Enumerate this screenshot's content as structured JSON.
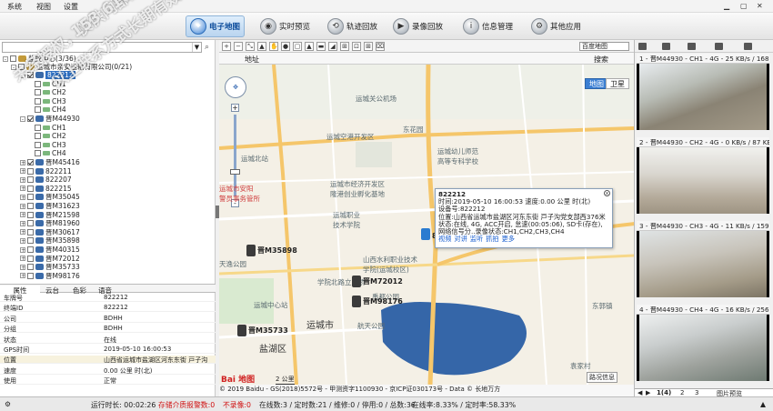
{
  "menu": {
    "system": "系统",
    "view": "视图",
    "settings": "设置"
  },
  "nav": {
    "items": [
      {
        "label": "电子地图",
        "icon": "map-icon"
      },
      {
        "label": "实时预览",
        "icon": "camera-icon"
      },
      {
        "label": "轨迹回放",
        "icon": "track-icon"
      },
      {
        "label": "录像回放",
        "icon": "video-icon"
      },
      {
        "label": "信息管理",
        "icon": "info-icon"
      },
      {
        "label": "其他应用",
        "icon": "apps-icon"
      }
    ]
  },
  "tree": {
    "root": "监控中心(3/36)",
    "company": "运城市亲安运输有限公司(0/21)",
    "vehicles": [
      {
        "label": "822212",
        "selected": true
      },
      {
        "label": "CH1"
      },
      {
        "label": "CH2"
      },
      {
        "label": "CH3"
      },
      {
        "label": "CH4"
      },
      {
        "label": "晋M44930"
      },
      {
        "label": "CH1"
      },
      {
        "label": "CH2"
      },
      {
        "label": "CH3"
      },
      {
        "label": "CH4"
      },
      {
        "label": "晋M45416"
      },
      {
        "label": "822211"
      },
      {
        "label": "822207"
      },
      {
        "label": "822215"
      },
      {
        "label": "晋M35045"
      },
      {
        "label": "晋M31623"
      },
      {
        "label": "晋M21598"
      },
      {
        "label": "晋M81960"
      },
      {
        "label": "晋M30617"
      },
      {
        "label": "晋M35898"
      },
      {
        "label": "晋M40315"
      },
      {
        "label": "晋M72012"
      },
      {
        "label": "晋M35733"
      },
      {
        "label": "晋M98176"
      }
    ]
  },
  "property_tabs": [
    "属性",
    "云台",
    "色彩",
    "语音"
  ],
  "properties": [
    {
      "k": "车牌号",
      "v": "822212"
    },
    {
      "k": "终端ID",
      "v": "822212"
    },
    {
      "k": "公司",
      "v": "BDHH"
    },
    {
      "k": "分组",
      "v": "BDHH"
    },
    {
      "k": "状态",
      "v": "在线"
    },
    {
      "k": "GPS时间",
      "v": "2019-05-10 16:00:53"
    },
    {
      "k": "位置",
      "v": "山西省运城市盐湖区河东东街 戸子沟"
    },
    {
      "k": "速度",
      "v": "0.00 公里 时(北)"
    },
    {
      "k": "使用",
      "v": "正常"
    }
  ],
  "map": {
    "address_label": "地址",
    "search_label": "搜索",
    "map_type": "百度地图",
    "type_map": "地图",
    "type_satellite": "卫星",
    "places": [
      {
        "t": "运城关公机场"
      },
      {
        "t": "运城空港开发区"
      },
      {
        "t": "运城北站"
      },
      {
        "t": "运城市经济开发区\n隆港创业孵化基地"
      },
      {
        "t": "运城幼儿师范\n高等专科学校"
      },
      {
        "t": "东花园"
      },
      {
        "t": "运城职业\n技术学院"
      },
      {
        "t": "山西水利职业技术\n学院(运城校区)"
      },
      {
        "t": "学院北路立交桥"
      },
      {
        "t": "运城中心站"
      },
      {
        "t": "运城市"
      },
      {
        "t": "盐湖区"
      },
      {
        "t": "航天公园"
      },
      {
        "t": "禹都公园"
      },
      {
        "t": "运城市安阳\n警员事务管所"
      },
      {
        "t": "天逸公园"
      },
      {
        "t": "袁家村"
      },
      {
        "t": "东郭镇"
      }
    ],
    "vehicles": [
      {
        "label": "822212"
      },
      {
        "label": "晋M35898"
      },
      {
        "label": "晋M72012"
      },
      {
        "label": "晋M35733"
      },
      {
        "label": "晋M98176"
      }
    ],
    "popup": {
      "title": "822212",
      "time": "时间:2019-05-10 16:00:53  速度:0.00 公里 时(北)",
      "device": "设备号:822212",
      "address": "位置:山西省运城市盐湖区河东东街 戸子沟党支部西376米",
      "status": "状态:在线, 4G, ACC开启, 怠速(00:05:06), SD卡(存在), 网络信号分..录像状态:CH1,CH2,CH3,CH4",
      "actions": [
        "视频",
        "对讲",
        "监听",
        "抓拍",
        "更多"
      ]
    },
    "footer": "© 2019 Baidu - GS(2018)5572号 - 甲测资字1100930 - 京ICP证030173号 - Data © 长地万方",
    "baidu_logo": "Bai 地图",
    "scale": "2 公里",
    "road_info": "路况信息"
  },
  "video": {
    "toolbar_icons": [
      "layout-icon",
      "grid-icon",
      "camera-icon",
      "record-icon",
      "play-icon"
    ],
    "panels": [
      {
        "head": "1 - 晋M44930 - CH1 - 4G - 25 KB/s / 168 KB"
      },
      {
        "head": "2 - 晋M44930 - CH2 - 4G - 0 KB/s / 87 KB"
      },
      {
        "head": "3 - 晋M44930 - CH3 - 4G - 11 KB/s / 159 KB"
      },
      {
        "head": "4 - 晋M44930 - CH4 - 4G - 16 KB/s / 256 KB"
      }
    ],
    "page": "1(4)",
    "pages": [
      "2",
      "3"
    ],
    "preview": "图片预览"
  },
  "status": {
    "runtime": "运行时长: 00:02:26",
    "alarm": "存储介质报警数:0",
    "unhandled": "不录像:0",
    "online": "在线数:3 / 定时数:21 / 维修:0 / 停用:0 / 总数:36",
    "rate": "在线率:8.33% / 定时率:58.33%"
  },
  "watermark": {
    "line1": "未经授权，仅供内部测试使用",
    "line2": "以上联系方式长期有效",
    "phone": "153 6169 6512"
  },
  "colors": {
    "accent": "#2f6fc0",
    "alarm_red": "#d01010",
    "map_bg": "#f3efe4",
    "water": "#3566a8"
  }
}
